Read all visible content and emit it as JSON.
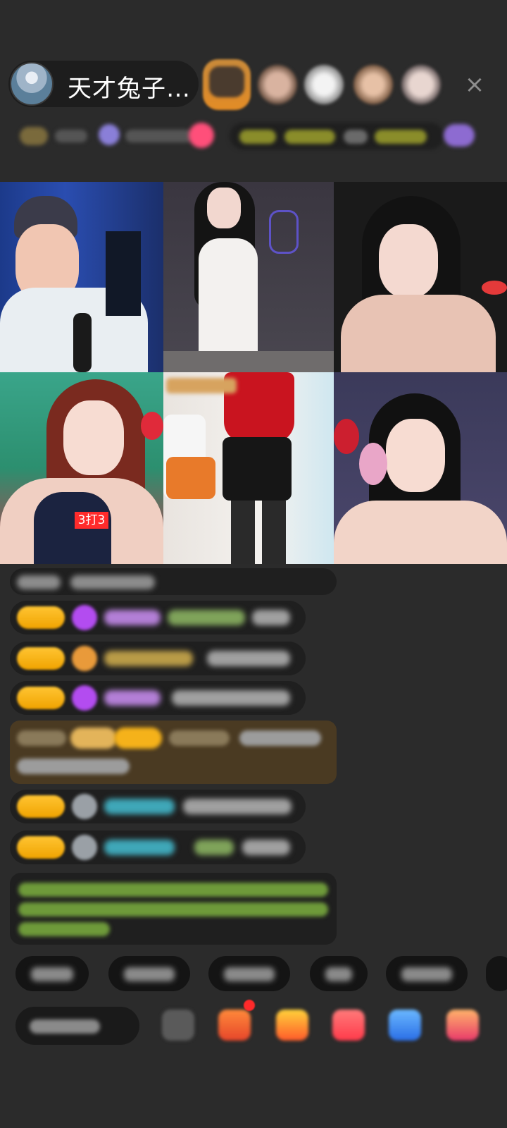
{
  "header": {
    "host_name": "天才兔子…",
    "close_icon": "×"
  },
  "video_tiles": [
    {
      "overlay_text": ""
    },
    {
      "overlay_text": ""
    },
    {
      "overlay_text": ""
    },
    {
      "overlay_text": "3打3"
    },
    {
      "overlay_text": ""
    },
    {
      "overlay_text": ""
    }
  ],
  "colors": {
    "background": "#2b2b2b",
    "badge_gold": "#f5b21a",
    "notice_bg": "#4a3a22",
    "live_red": "#ff2a2a"
  },
  "icons": [
    "close-icon",
    "gift-icon",
    "pk-icon",
    "emoji-icon",
    "share-icon",
    "more-icon"
  ]
}
